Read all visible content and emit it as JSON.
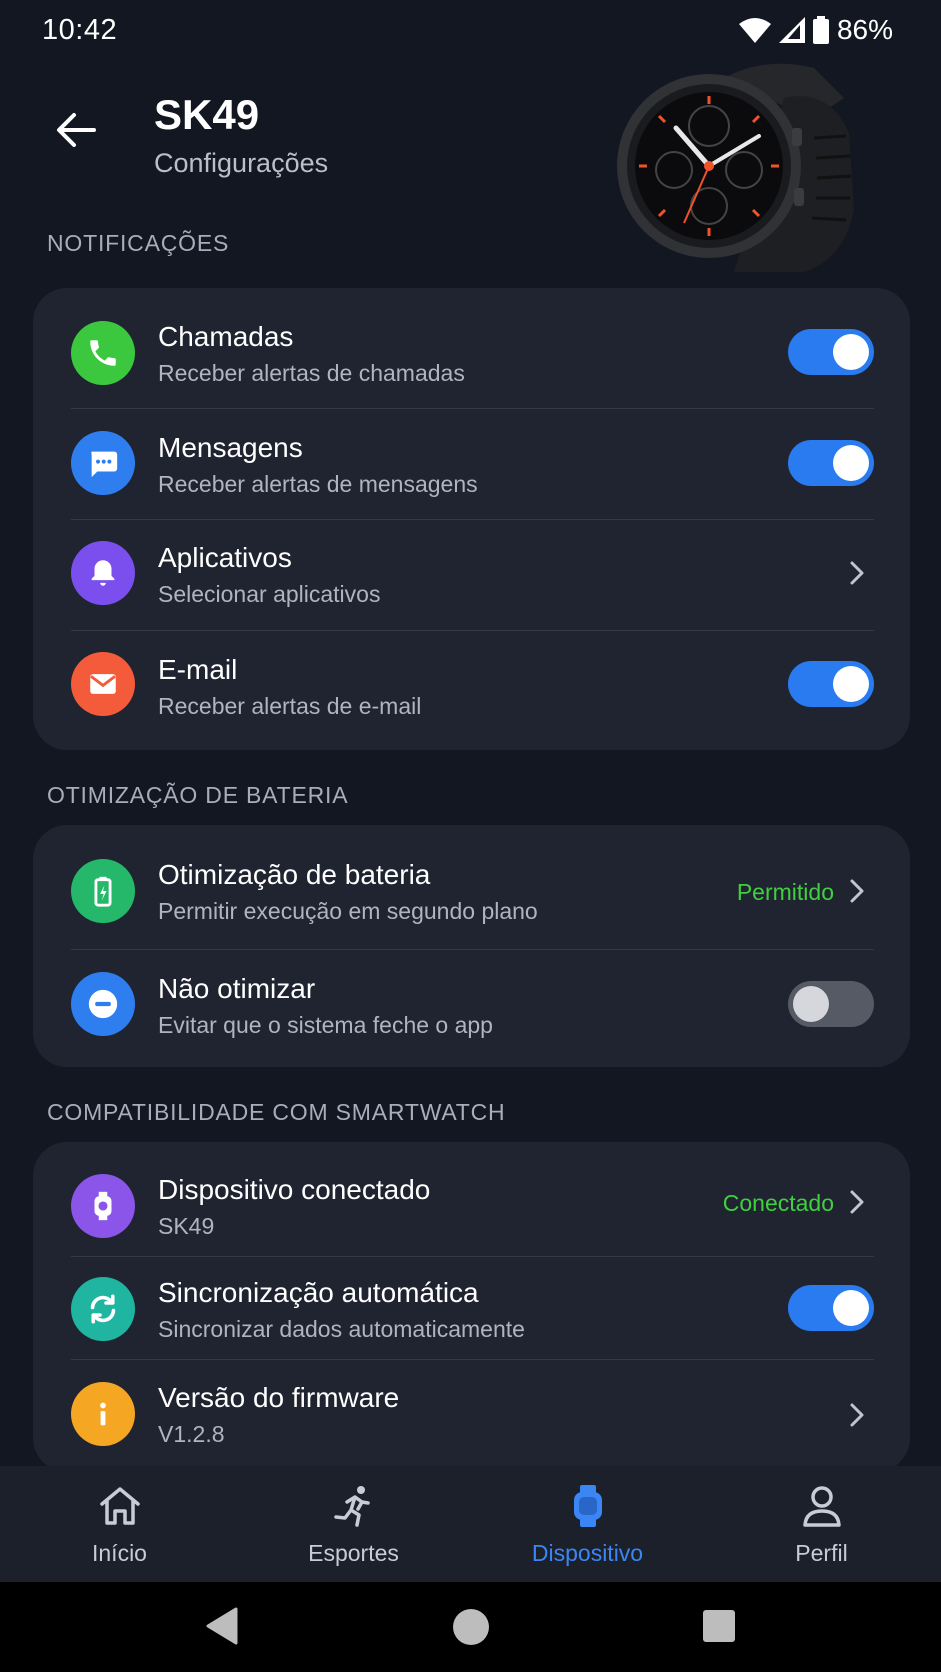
{
  "status_bar": {
    "time": "10:42",
    "battery": "86%"
  },
  "header": {
    "title": "SK49",
    "subtitle": "Configurações"
  },
  "sections": {
    "notifications": {
      "title": "NOTIFICAÇÕES",
      "items": [
        {
          "label": "Chamadas",
          "sub": "Receber alertas de chamadas",
          "icon": "phone-icon",
          "color": "#3bc83f",
          "toggle": true
        },
        {
          "label": "Mensagens",
          "sub": "Receber alertas de mensagens",
          "icon": "message-icon",
          "color": "#2f7ef0",
          "toggle": true
        },
        {
          "label": "Aplicativos",
          "sub": "Selecionar aplicativos",
          "icon": "bell-icon",
          "color": "#7b4fee"
        },
        {
          "label": "E-mail",
          "sub": "Receber alertas de e-mail",
          "icon": "mail-icon",
          "color": "#f35b3a",
          "toggle": true
        }
      ]
    },
    "battery": {
      "title": "OTIMIZAÇÃO DE BATERIA",
      "items": [
        {
          "label": "Otimização de bateria",
          "sub": "Permitir execução em segundo plano",
          "icon": "battery-icon",
          "color": "#25b86a",
          "status": "Permitido"
        },
        {
          "label": "Não otimizar",
          "sub": "Evitar que o sistema feche o app",
          "icon": "minus-circle-icon",
          "color": "#2f7ef0",
          "toggle": false
        }
      ]
    },
    "compat": {
      "title": "COMPATIBILIDADE COM SMARTWATCH",
      "items": [
        {
          "label": "Dispositivo conectado",
          "sub": "SK49",
          "icon": "watch-icon",
          "color": "#8a55e8",
          "status": "Conectado"
        },
        {
          "label": "Sincronização automática",
          "sub": "Sincronizar dados automaticamente",
          "icon": "sync-icon",
          "color": "#1fb5a0",
          "toggle": true
        },
        {
          "label": "Versão do firmware",
          "sub": "V1.2.8",
          "icon": "info-icon",
          "color": "#f5a623"
        }
      ]
    }
  },
  "nav": {
    "items": [
      {
        "label": "Início",
        "icon": "home-icon"
      },
      {
        "label": "Esportes",
        "icon": "running-icon"
      },
      {
        "label": "Dispositivo",
        "icon": "watch-icon",
        "active": true
      },
      {
        "label": "Perfil",
        "icon": "person-icon"
      }
    ]
  },
  "colors": {
    "accent": "#2a7bf0",
    "background": "#121722",
    "card": "#1f2430",
    "status_green": "#3fcf3f"
  }
}
